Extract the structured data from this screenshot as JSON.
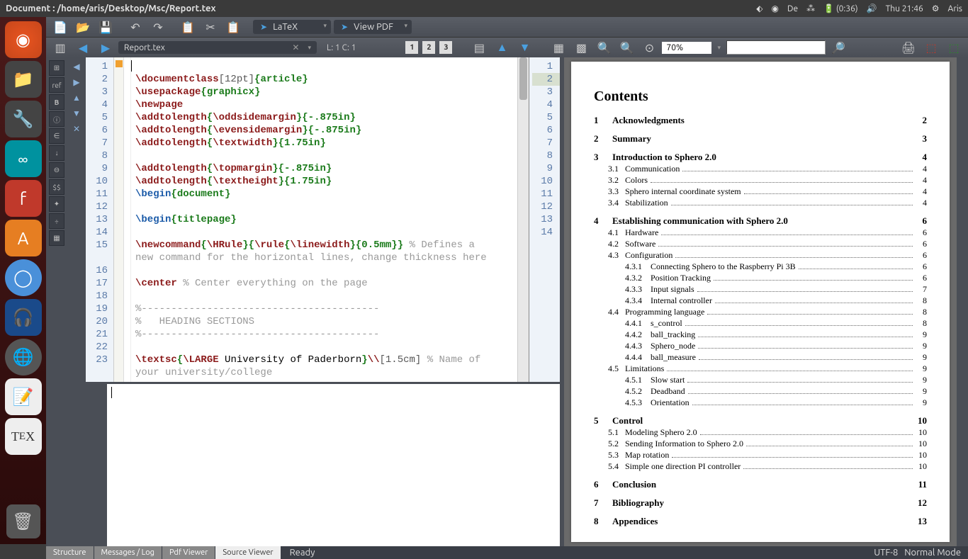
{
  "menubar": {
    "title": "Document : /home/aris/Desktop/Msc/Report.tex",
    "lang": "De",
    "battery": "(0:36)",
    "time": "Thu 21:46",
    "user": "Aris"
  },
  "toolbar1": {
    "compile_label": "LaTeX",
    "view_label": "View PDF",
    "zoom": "70%"
  },
  "toolbar2": {
    "filename": "Report.tex",
    "cursor": "L: 1 C: 1"
  },
  "line_numbers": [
    "1",
    "2",
    "3",
    "4",
    "5",
    "6",
    "7",
    "8",
    "9",
    "10",
    "11",
    "12",
    "13",
    "14",
    "15",
    "",
    "16",
    "17",
    "18",
    "19",
    "20",
    "21",
    "22",
    "23"
  ],
  "mini_line_numbers": [
    "1",
    "2",
    "3",
    "4",
    "5",
    "6",
    "7",
    "8",
    "9",
    "10",
    "11",
    "12",
    "13",
    "14"
  ],
  "pdf": {
    "contents_title": "Contents",
    "toc": [
      {
        "lvl": "sec",
        "num": "1",
        "title": "Acknowledgments",
        "page": "2"
      },
      {
        "lvl": "sec",
        "num": "2",
        "title": "Summary",
        "page": "3"
      },
      {
        "lvl": "sec",
        "num": "3",
        "title": "Introduction to Sphero 2.0",
        "page": "4"
      },
      {
        "lvl": "sub",
        "num": "3.1",
        "title": "Communication",
        "page": "4"
      },
      {
        "lvl": "sub",
        "num": "3.2",
        "title": "Colors",
        "page": "4"
      },
      {
        "lvl": "sub",
        "num": "3.3",
        "title": "Sphero internal coordinate system",
        "page": "4"
      },
      {
        "lvl": "sub",
        "num": "3.4",
        "title": "Stabilization",
        "page": "4"
      },
      {
        "lvl": "sec",
        "num": "4",
        "title": "Establishing communication with Sphero 2.0",
        "page": "6"
      },
      {
        "lvl": "sub",
        "num": "4.1",
        "title": "Hardware",
        "page": "6"
      },
      {
        "lvl": "sub",
        "num": "4.2",
        "title": "Software",
        "page": "6"
      },
      {
        "lvl": "sub",
        "num": "4.3",
        "title": "Configuration",
        "page": "6"
      },
      {
        "lvl": "subsub",
        "num": "4.3.1",
        "title": "Connecting Sphero to the Raspberry Pi 3B",
        "page": "6"
      },
      {
        "lvl": "subsub",
        "num": "4.3.2",
        "title": "Position Tracking",
        "page": "6"
      },
      {
        "lvl": "subsub",
        "num": "4.3.3",
        "title": "Input signals",
        "page": "7"
      },
      {
        "lvl": "subsub",
        "num": "4.3.4",
        "title": "Internal controller",
        "page": "8"
      },
      {
        "lvl": "sub",
        "num": "4.4",
        "title": "Programming language",
        "page": "8"
      },
      {
        "lvl": "subsub",
        "num": "4.4.1",
        "title": "s_control",
        "page": "8"
      },
      {
        "lvl": "subsub",
        "num": "4.4.2",
        "title": "ball_tracking",
        "page": "9"
      },
      {
        "lvl": "subsub",
        "num": "4.4.3",
        "title": "Sphero_node",
        "page": "9"
      },
      {
        "lvl": "subsub",
        "num": "4.4.4",
        "title": "ball_measure",
        "page": "9"
      },
      {
        "lvl": "sub",
        "num": "4.5",
        "title": "Limitations",
        "page": "9"
      },
      {
        "lvl": "subsub",
        "num": "4.5.1",
        "title": "Slow start",
        "page": "9"
      },
      {
        "lvl": "subsub",
        "num": "4.5.2",
        "title": "Deadband",
        "page": "9"
      },
      {
        "lvl": "subsub",
        "num": "4.5.3",
        "title": "Orientation",
        "page": "9"
      },
      {
        "lvl": "sec",
        "num": "5",
        "title": "Control",
        "page": "10"
      },
      {
        "lvl": "sub",
        "num": "5.1",
        "title": "Modeling Sphero 2.0",
        "page": "10"
      },
      {
        "lvl": "sub",
        "num": "5.2",
        "title": "Sending Information to Sphero 2.0",
        "page": "10"
      },
      {
        "lvl": "sub",
        "num": "5.3",
        "title": "Map rotation",
        "page": "10"
      },
      {
        "lvl": "sub",
        "num": "5.4",
        "title": "Simple one direction PI controller",
        "page": "10"
      },
      {
        "lvl": "sec",
        "num": "6",
        "title": "Conclusion",
        "page": "11"
      },
      {
        "lvl": "sec",
        "num": "7",
        "title": "Bibliography",
        "page": "12"
      },
      {
        "lvl": "sec",
        "num": "8",
        "title": "Appendices",
        "page": "13"
      }
    ]
  },
  "statusbar": {
    "tabs": [
      "Structure",
      "Messages / Log",
      "Pdf Viewer",
      "Source Viewer"
    ],
    "ready": "Ready",
    "encoding": "UTF-8",
    "mode": "Normal Mode"
  },
  "code_lines": [
    [],
    [
      {
        "c": "tok-cmd",
        "t": "\\documentclass"
      },
      {
        "c": "tok-opt",
        "t": "[12pt]"
      },
      {
        "c": "tok-brace",
        "t": "{article}"
      }
    ],
    [
      {
        "c": "tok-cmd",
        "t": "\\usepackage"
      },
      {
        "c": "tok-brace",
        "t": "{graphicx}"
      }
    ],
    [
      {
        "c": "tok-cmd",
        "t": "\\newpage"
      }
    ],
    [
      {
        "c": "tok-cmd",
        "t": "\\addtolength"
      },
      {
        "c": "tok-brace",
        "t": "{"
      },
      {
        "c": "tok-cmd",
        "t": "\\oddsidemargin"
      },
      {
        "c": "tok-brace",
        "t": "}{-.875in}"
      }
    ],
    [
      {
        "c": "tok-cmd",
        "t": "\\addtolength"
      },
      {
        "c": "tok-brace",
        "t": "{"
      },
      {
        "c": "tok-cmd",
        "t": "\\evensidemargin"
      },
      {
        "c": "tok-brace",
        "t": "}{-.875in}"
      }
    ],
    [
      {
        "c": "tok-cmd",
        "t": "\\addtolength"
      },
      {
        "c": "tok-brace",
        "t": "{"
      },
      {
        "c": "tok-cmd",
        "t": "\\textwidth"
      },
      {
        "c": "tok-brace",
        "t": "}{1.75in}"
      }
    ],
    [],
    [
      {
        "c": "tok-cmd",
        "t": "\\addtolength"
      },
      {
        "c": "tok-brace",
        "t": "{"
      },
      {
        "c": "tok-cmd",
        "t": "\\topmargin"
      },
      {
        "c": "tok-brace",
        "t": "}{-.875in}"
      }
    ],
    [
      {
        "c": "tok-cmd",
        "t": "\\addtolength"
      },
      {
        "c": "tok-brace",
        "t": "{"
      },
      {
        "c": "tok-cmd",
        "t": "\\textheight"
      },
      {
        "c": "tok-brace",
        "t": "}{1.75in}"
      }
    ],
    [
      {
        "c": "tok-kw",
        "t": "\\begin"
      },
      {
        "c": "tok-brace",
        "t": "{document}"
      }
    ],
    [],
    [
      {
        "c": "tok-kw",
        "t": "\\begin"
      },
      {
        "c": "tok-brace",
        "t": "{titlepage}"
      }
    ],
    [],
    [
      {
        "c": "tok-cmd",
        "t": "\\newcommand"
      },
      {
        "c": "tok-brace",
        "t": "{"
      },
      {
        "c": "tok-cmd",
        "t": "\\HRule"
      },
      {
        "c": "tok-brace",
        "t": "}{"
      },
      {
        "c": "tok-cmd",
        "t": "\\rule"
      },
      {
        "c": "tok-brace",
        "t": "{"
      },
      {
        "c": "tok-cmd",
        "t": "\\linewidth"
      },
      {
        "c": "tok-brace",
        "t": "}{0.5mm}}"
      },
      {
        "c": "tok-comment",
        "t": " % Defines a"
      }
    ],
    [
      {
        "c": "tok-comment",
        "t": "new command for the horizontal lines, change thickness here"
      }
    ],
    [],
    [
      {
        "c": "tok-cmd",
        "t": "\\center"
      },
      {
        "c": "tok-comment",
        "t": " % Center everything on the page"
      }
    ],
    [],
    [
      {
        "c": "tok-comment",
        "t": "%----------------------------------------"
      }
    ],
    [
      {
        "c": "tok-comment",
        "t": "%   HEADING SECTIONS"
      }
    ],
    [
      {
        "c": "tok-comment",
        "t": "%----------------------------------------"
      }
    ],
    [],
    [
      {
        "c": "tok-cmd",
        "t": "\\textsc"
      },
      {
        "c": "tok-brace",
        "t": "{"
      },
      {
        "c": "tok-cmd",
        "t": "\\LARGE"
      },
      {
        "c": "",
        "t": " University of Paderborn"
      },
      {
        "c": "tok-brace",
        "t": "}"
      },
      {
        "c": "tok-cmd",
        "t": "\\\\"
      },
      {
        "c": "tok-opt",
        "t": "[1.5cm]"
      },
      {
        "c": "tok-comment",
        "t": " % Name of"
      }
    ],
    [
      {
        "c": "tok-comment",
        "t": "your university/college"
      }
    ]
  ]
}
